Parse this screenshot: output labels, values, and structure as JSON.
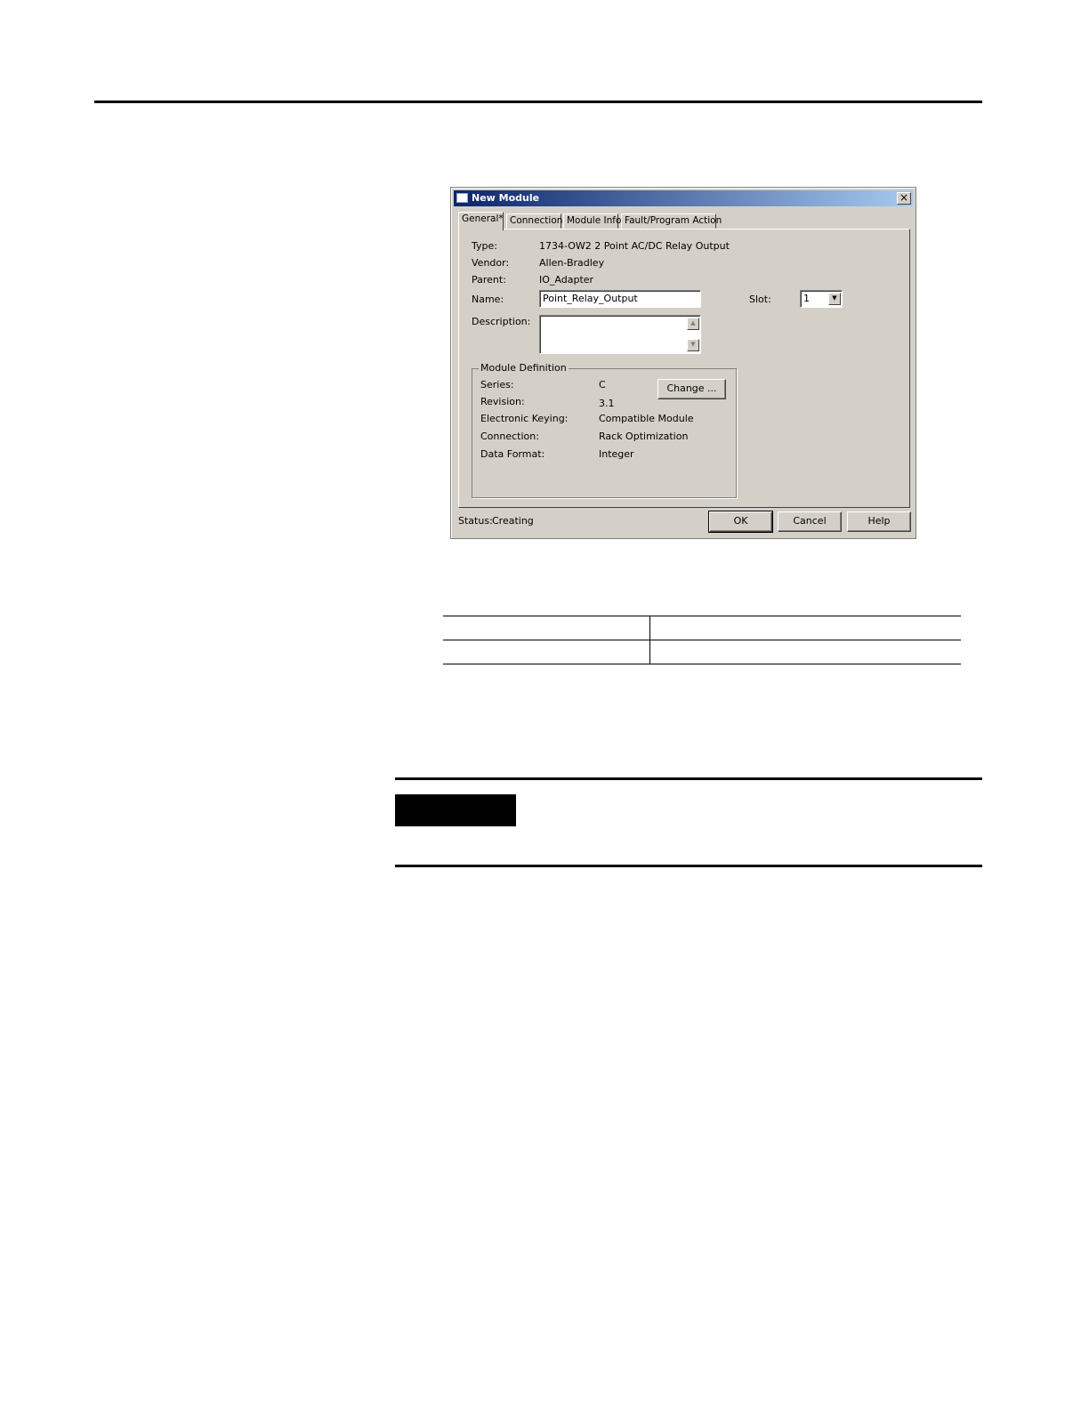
{
  "dialog": {
    "title": "New Module",
    "close_glyph": "×",
    "tabs": [
      {
        "label": "General*"
      },
      {
        "label": "Connection"
      },
      {
        "label": "Module Info"
      },
      {
        "label": "Fault/Program Action"
      }
    ],
    "general": {
      "type_label": "Type:",
      "type_value": "1734-OW2 2 Point AC/DC Relay Output",
      "vendor_label": "Vendor:",
      "vendor_value": "Allen-Bradley",
      "parent_label": "Parent:",
      "parent_value": "IO_Adapter",
      "name_label": "Name:",
      "name_value": "Point_Relay_Output",
      "slot_label": "Slot:",
      "slot_value": "1",
      "description_label": "Description:",
      "description_value": ""
    },
    "module_definition": {
      "title": "Module Definition",
      "series_label": "Series:",
      "series_value": "C",
      "revision_label": "Revision:",
      "revision_value": "3.1",
      "keying_label": "Electronic Keying:",
      "keying_value": "Compatible Module",
      "connection_label": "Connection:",
      "connection_value": "Rack Optimization",
      "data_format_label": "Data Format:",
      "data_format_value": "Integer",
      "change_button": "Change ..."
    },
    "status_label": "Status:",
    "status_value": "Creating",
    "buttons": {
      "ok": "OK",
      "cancel": "Cancel",
      "help": "Help"
    }
  },
  "icons": {
    "dropdown": "down-arrow-icon",
    "scroll_up": "up-arrow-icon",
    "scroll_down": "down-arrow-icon",
    "close": "close-icon"
  },
  "colors": {
    "titlebar_start": "#0a246a",
    "titlebar_end": "#a6caf0",
    "dialog_bg": "#d4d0c8"
  }
}
